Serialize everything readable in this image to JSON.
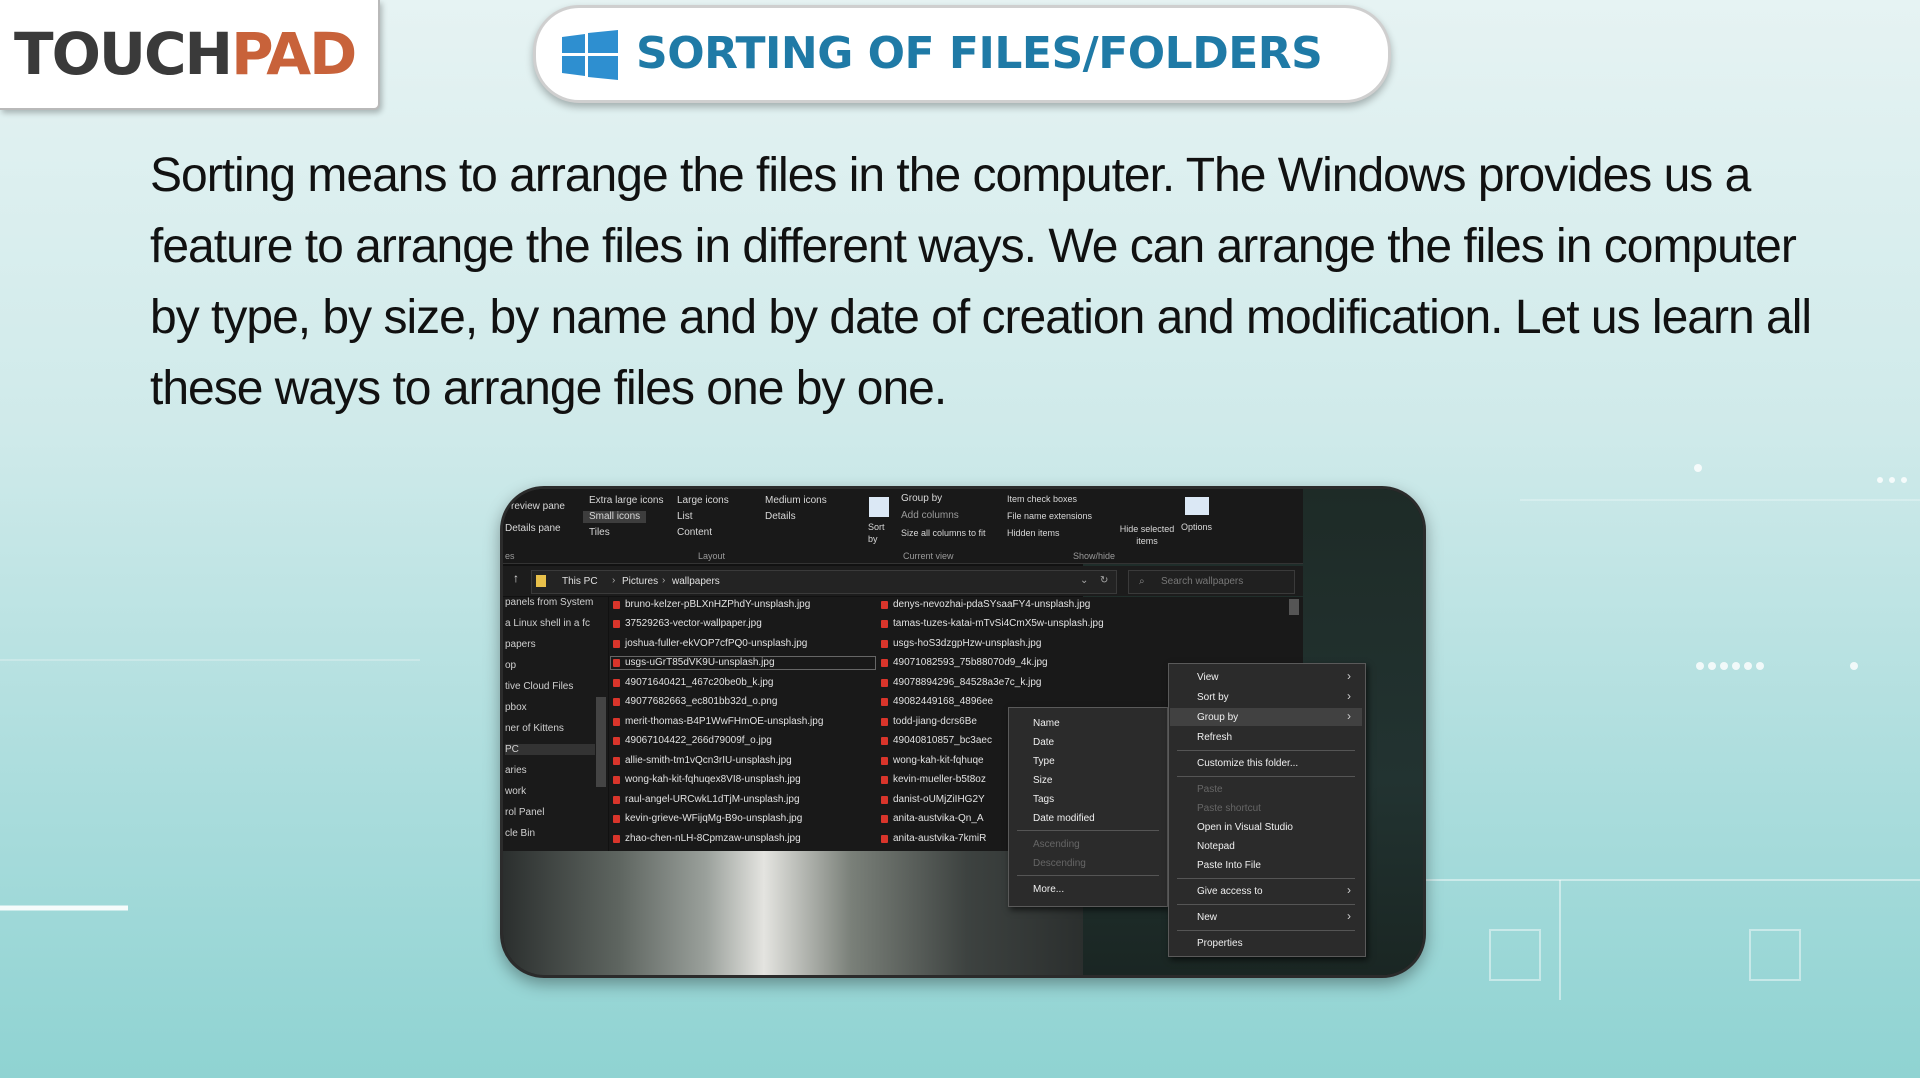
{
  "brand": {
    "logo_left": "TOUCH",
    "logo_right": "PAD",
    "accent": "#c8623a"
  },
  "header": {
    "title": "SORTING OF FILES/FOLDERS",
    "title_color": "#1f7aa6",
    "icon": "windows-logo-icon"
  },
  "body": {
    "paragraph": "Sorting means to arrange the files in the computer. The Windows provides us a feature to arrange the files in different ways. We can arrange the files in computer by type, by size, by name and by date of creation and modification. Let us learn all these ways to arrange files one by one."
  },
  "explorer": {
    "ribbon": {
      "preview_pane": "review pane",
      "details_pane": "Details pane",
      "panes_short": "es",
      "layout": [
        "Extra large icons",
        "Large icons",
        "Medium icons",
        "Small icons",
        "List",
        "Details",
        "Tiles",
        "Content"
      ],
      "layout_label": "Layout",
      "sort_by": "Sort\nby",
      "group_by": "Group by",
      "add_columns": "Add columns",
      "size_all": "Size all columns to fit",
      "current_view": "Current view",
      "item_check": "Item check boxes",
      "file_ext": "File name extensions",
      "hidden_items": "Hidden items",
      "hide_selected": "Hide selected items",
      "showhide": "Show/hide",
      "options": "Options"
    },
    "address": {
      "path": [
        "This PC",
        "Pictures",
        "wallpapers"
      ],
      "search_placeholder": "Search wallpapers"
    },
    "nav_items": [
      "panels from System",
      "a Linux shell in a fc",
      "papers",
      "op",
      "tive Cloud Files",
      "pbox",
      "ner of Kittens",
      "PC",
      "aries",
      "work",
      "rol Panel",
      "cle Bin"
    ],
    "files_col1": [
      "bruno-kelzer-pBLXnHZPhdY-unsplash.jpg",
      "37529263-vector-wallpaper.jpg",
      "joshua-fuller-ekVOP7cfPQ0-unsplash.jpg",
      "usgs-uGrT85dVK9U-unsplash.jpg",
      "49071640421_467c20be0b_k.jpg",
      "49077682663_ec801bb32d_o.png",
      "merit-thomas-B4P1WwFHmOE-unsplash.jpg",
      "49067104422_266d79009f_o.jpg",
      "allie-smith-tm1vQcn3rIU-unsplash.jpg",
      "wong-kah-kit-fqhuqex8VI8-unsplash.jpg",
      "raul-angel-URCwkL1dTjM-unsplash.jpg",
      "kevin-grieve-WFijqMg-B9o-unsplash.jpg",
      "zhao-chen-nLH-8Cpmzaw-unsplash.jpg"
    ],
    "files_col2": [
      "denys-nevozhai-pdaSYsaaFY4-unsplash.jpg",
      "tamas-tuzes-katai-mTvSi4CmX5w-unsplash.jpg",
      "usgs-hoS3dzgpHzw-unsplash.jpg",
      "49071082593_75b88070d9_4k.jpg",
      "49078894296_84528a3e7c_k.jpg",
      "49082449168_4896ee",
      "todd-jiang-dcrs6Be",
      "49040810857_bc3aec",
      "wong-kah-kit-fqhuqe",
      "kevin-mueller-b5t8oz",
      "danist-oUMjZiIHG2Y",
      "anita-austvika-Qn_A",
      "anita-austvika-7kmiR"
    ],
    "context_menu": {
      "items": [
        "View",
        "Sort by",
        "Group by",
        "Refresh",
        "Customize this folder...",
        "Paste",
        "Paste shortcut",
        "Open in Visual Studio",
        "Notepad",
        "Paste Into File",
        "Give access to",
        "New",
        "Properties"
      ]
    },
    "submenu": {
      "items": [
        "Name",
        "Date",
        "Type",
        "Size",
        "Tags",
        "Date modified",
        "Ascending",
        "Descending",
        "More..."
      ]
    }
  }
}
